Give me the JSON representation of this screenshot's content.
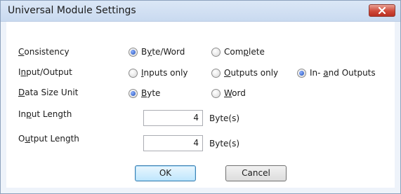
{
  "window": {
    "title": "Universal Module Settings"
  },
  "rows": {
    "consistency": {
      "label": {
        "pre": "",
        "u": "C",
        "post": "onsistency"
      },
      "options": [
        {
          "pre": "B",
          "u": "y",
          "post": "te/Word",
          "selected": true
        },
        {
          "pre": "Com",
          "u": "p",
          "post": "lete",
          "selected": false
        }
      ]
    },
    "io": {
      "label": {
        "pre": "I",
        "u": "n",
        "post": "put/Output"
      },
      "options": [
        {
          "pre": "",
          "u": "I",
          "post": "nputs only",
          "selected": false
        },
        {
          "pre": "",
          "u": "O",
          "post": "utputs only",
          "selected": false
        },
        {
          "pre": "In- ",
          "u": "a",
          "post": "nd Outputs",
          "selected": true
        }
      ]
    },
    "data_size": {
      "label": {
        "pre": "",
        "u": "D",
        "post": "ata Size Unit"
      },
      "options": [
        {
          "pre": "",
          "u": "B",
          "post": "yte",
          "selected": true
        },
        {
          "pre": "",
          "u": "W",
          "post": "ord",
          "selected": false
        }
      ]
    },
    "input_length": {
      "label": {
        "pre": "In",
        "u": "p",
        "post": "ut Length"
      },
      "value": "4",
      "unit": "Byte(s)"
    },
    "output_length": {
      "label": {
        "pre": "O",
        "u": "u",
        "post": "tput Length"
      },
      "value": "4",
      "unit": "Byte(s)"
    }
  },
  "buttons": {
    "ok": "OK",
    "cancel": "Cancel"
  },
  "colors": {
    "titlebar": "#c9daf0",
    "dialog_border": "#8da2bd",
    "close": "#cf4a3a",
    "radio_dot": "#1f4fb8"
  }
}
